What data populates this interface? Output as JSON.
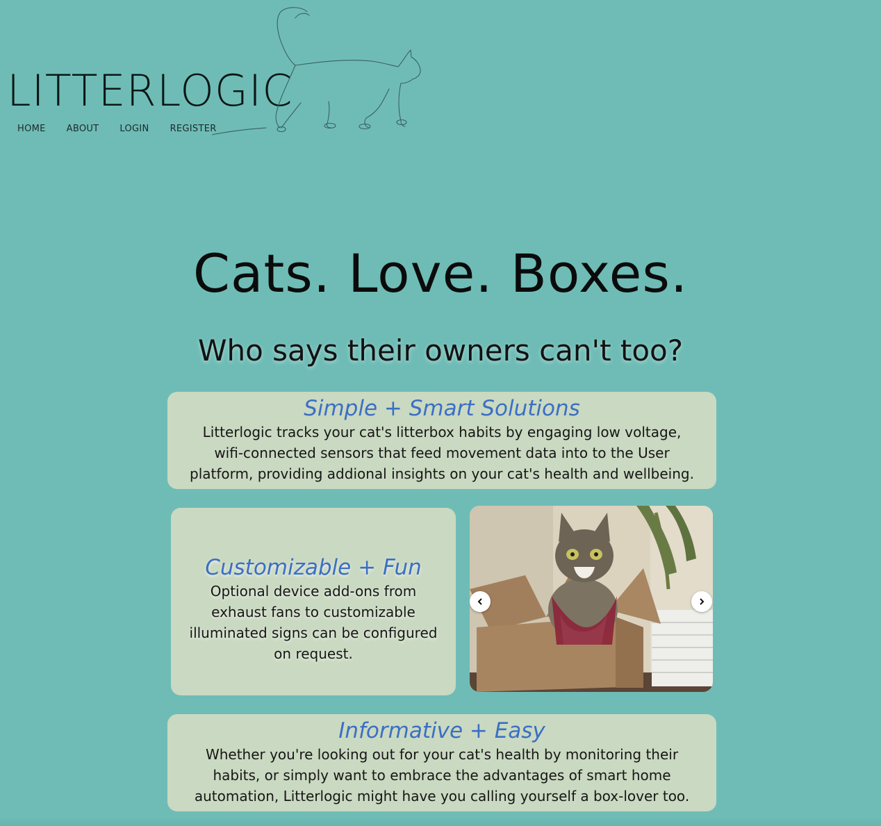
{
  "brand": {
    "name": "LITTERLOGIC",
    "logo_icon": "walking-cat-outline"
  },
  "nav": {
    "items": [
      {
        "label": "HOME"
      },
      {
        "label": "ABOUT"
      },
      {
        "label": "LOGIN"
      },
      {
        "label": "REGISTER"
      }
    ]
  },
  "hero": {
    "title": "Cats. Love. Boxes.",
    "subtitle": "Who says their owners can't too?"
  },
  "features": {
    "simple": {
      "title": "Simple + Smart Solutions",
      "body": "Litterlogic tracks your cat's litterbox habits by engaging low voltage, wifi-connected sensors that feed movement data into to the User platform, providing addional insights on your cat's health and wellbeing."
    },
    "custom": {
      "title": "Customizable + Fun",
      "body": "Optional device add-ons from exhaust fans to customizable illuminated signs can be configured on request."
    },
    "info": {
      "title": "Informative + Easy",
      "body": "Whether you're looking out for your cat's health by monitoring their habits, or simply want to embrace the advantages of smart home automation, Litterlogic might have you calling yourself a box-lover too."
    }
  },
  "carousel": {
    "prev_icon": "chevron-left-icon",
    "next_icon": "chevron-right-icon"
  },
  "colors": {
    "background": "#6fbcb6",
    "card": "#cad9c1",
    "accent": "#3b6fc4"
  }
}
